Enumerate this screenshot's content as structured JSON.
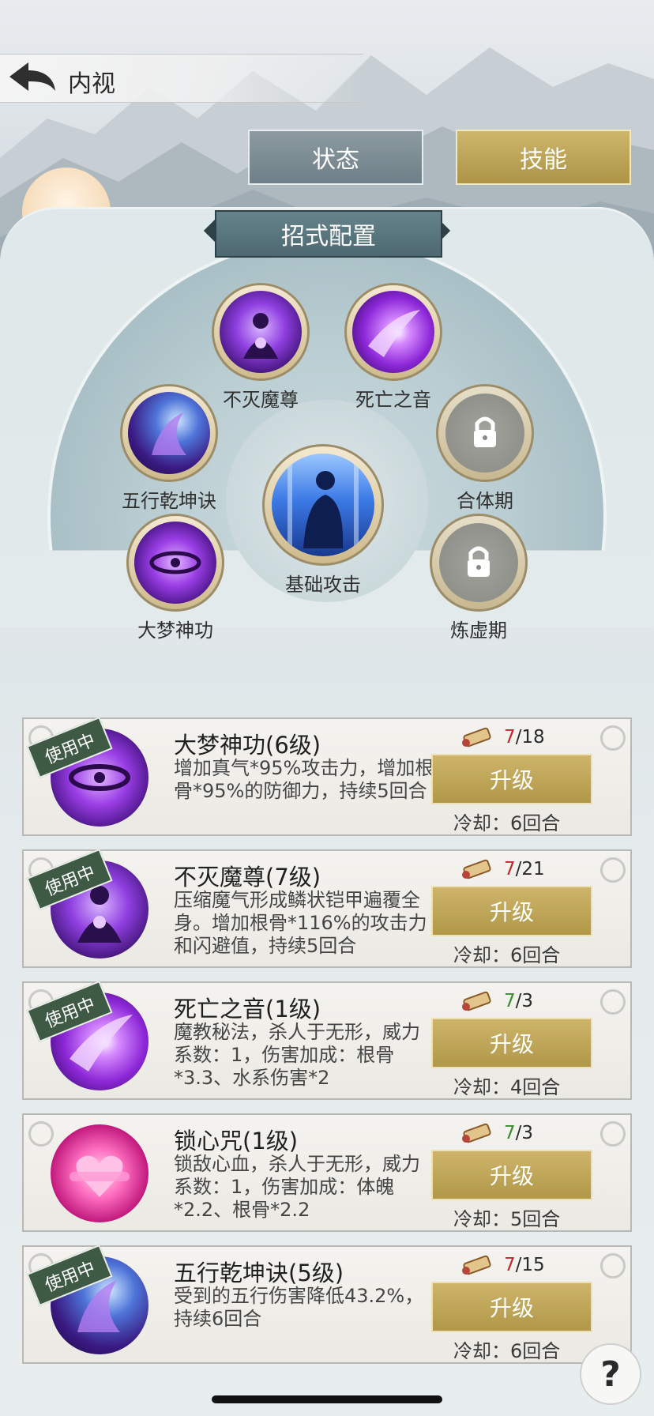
{
  "header": {
    "title": "内视"
  },
  "tabs": [
    {
      "label": "状态",
      "active": false
    },
    {
      "label": "技能",
      "active": true
    }
  ],
  "config": {
    "banner": "招式配置",
    "slots": [
      {
        "label": "不灭魔尊",
        "icon": "demon-lord-skill-icon",
        "locked": false
      },
      {
        "label": "死亡之音",
        "icon": "death-sound-skill-icon",
        "locked": false
      },
      {
        "label": "五行乾坤诀",
        "icon": "five-elements-skill-icon",
        "locked": false
      },
      {
        "label": "合体期",
        "icon": "lock-icon",
        "locked": true
      },
      {
        "label": "基础攻击",
        "icon": "basic-attack-skill-icon",
        "locked": false
      },
      {
        "label": "大梦神功",
        "icon": "dream-skill-icon",
        "locked": false
      },
      {
        "label": "炼虚期",
        "icon": "lock-icon",
        "locked": true
      }
    ]
  },
  "skills": [
    {
      "name": "大梦神功(6级)",
      "desc": "增加真气*95%攻击力，增加根骨*95%的防御力，持续5回合",
      "badge": "使用中",
      "current": "7",
      "total": "/18",
      "enough": false,
      "upgrade": "升级",
      "cooldown": "冷却：6回合",
      "icon": "dream-skill-icon"
    },
    {
      "name": "不灭魔尊(7级)",
      "desc": "压缩魔气形成鳞状铠甲遍覆全身。增加根骨*116%的攻击力和闪避值，持续5回合",
      "badge": "使用中",
      "current": "7",
      "total": "/21",
      "enough": false,
      "upgrade": "升级",
      "cooldown": "冷却：6回合",
      "icon": "demon-lord-skill-icon"
    },
    {
      "name": "死亡之音(1级)",
      "desc": "魔教秘法，杀人于无形，威力系数：1，伤害加成：根骨*3.3、水系伤害*2",
      "badge": "使用中",
      "current": "7",
      "total": "/3",
      "enough": true,
      "upgrade": "升级",
      "cooldown": "冷却：4回合",
      "icon": "death-sound-skill-icon"
    },
    {
      "name": "锁心咒(1级)",
      "desc": "锁敌心血，杀人于无形，威力系数：1，伤害加成：体魄*2.2、根骨*2.2",
      "badge": "",
      "current": "7",
      "total": "/3",
      "enough": true,
      "upgrade": "升级",
      "cooldown": "冷却：5回合",
      "icon": "heart-lock-skill-icon"
    },
    {
      "name": "五行乾坤诀(5级)",
      "desc": "受到的五行伤害降低43.2%，持续6回合",
      "badge": "使用中",
      "current": "7",
      "total": "/15",
      "enough": false,
      "upgrade": "升级",
      "cooldown": "冷却：6回合",
      "icon": "five-elements-skill-icon"
    }
  ],
  "help": {
    "label": "?"
  }
}
